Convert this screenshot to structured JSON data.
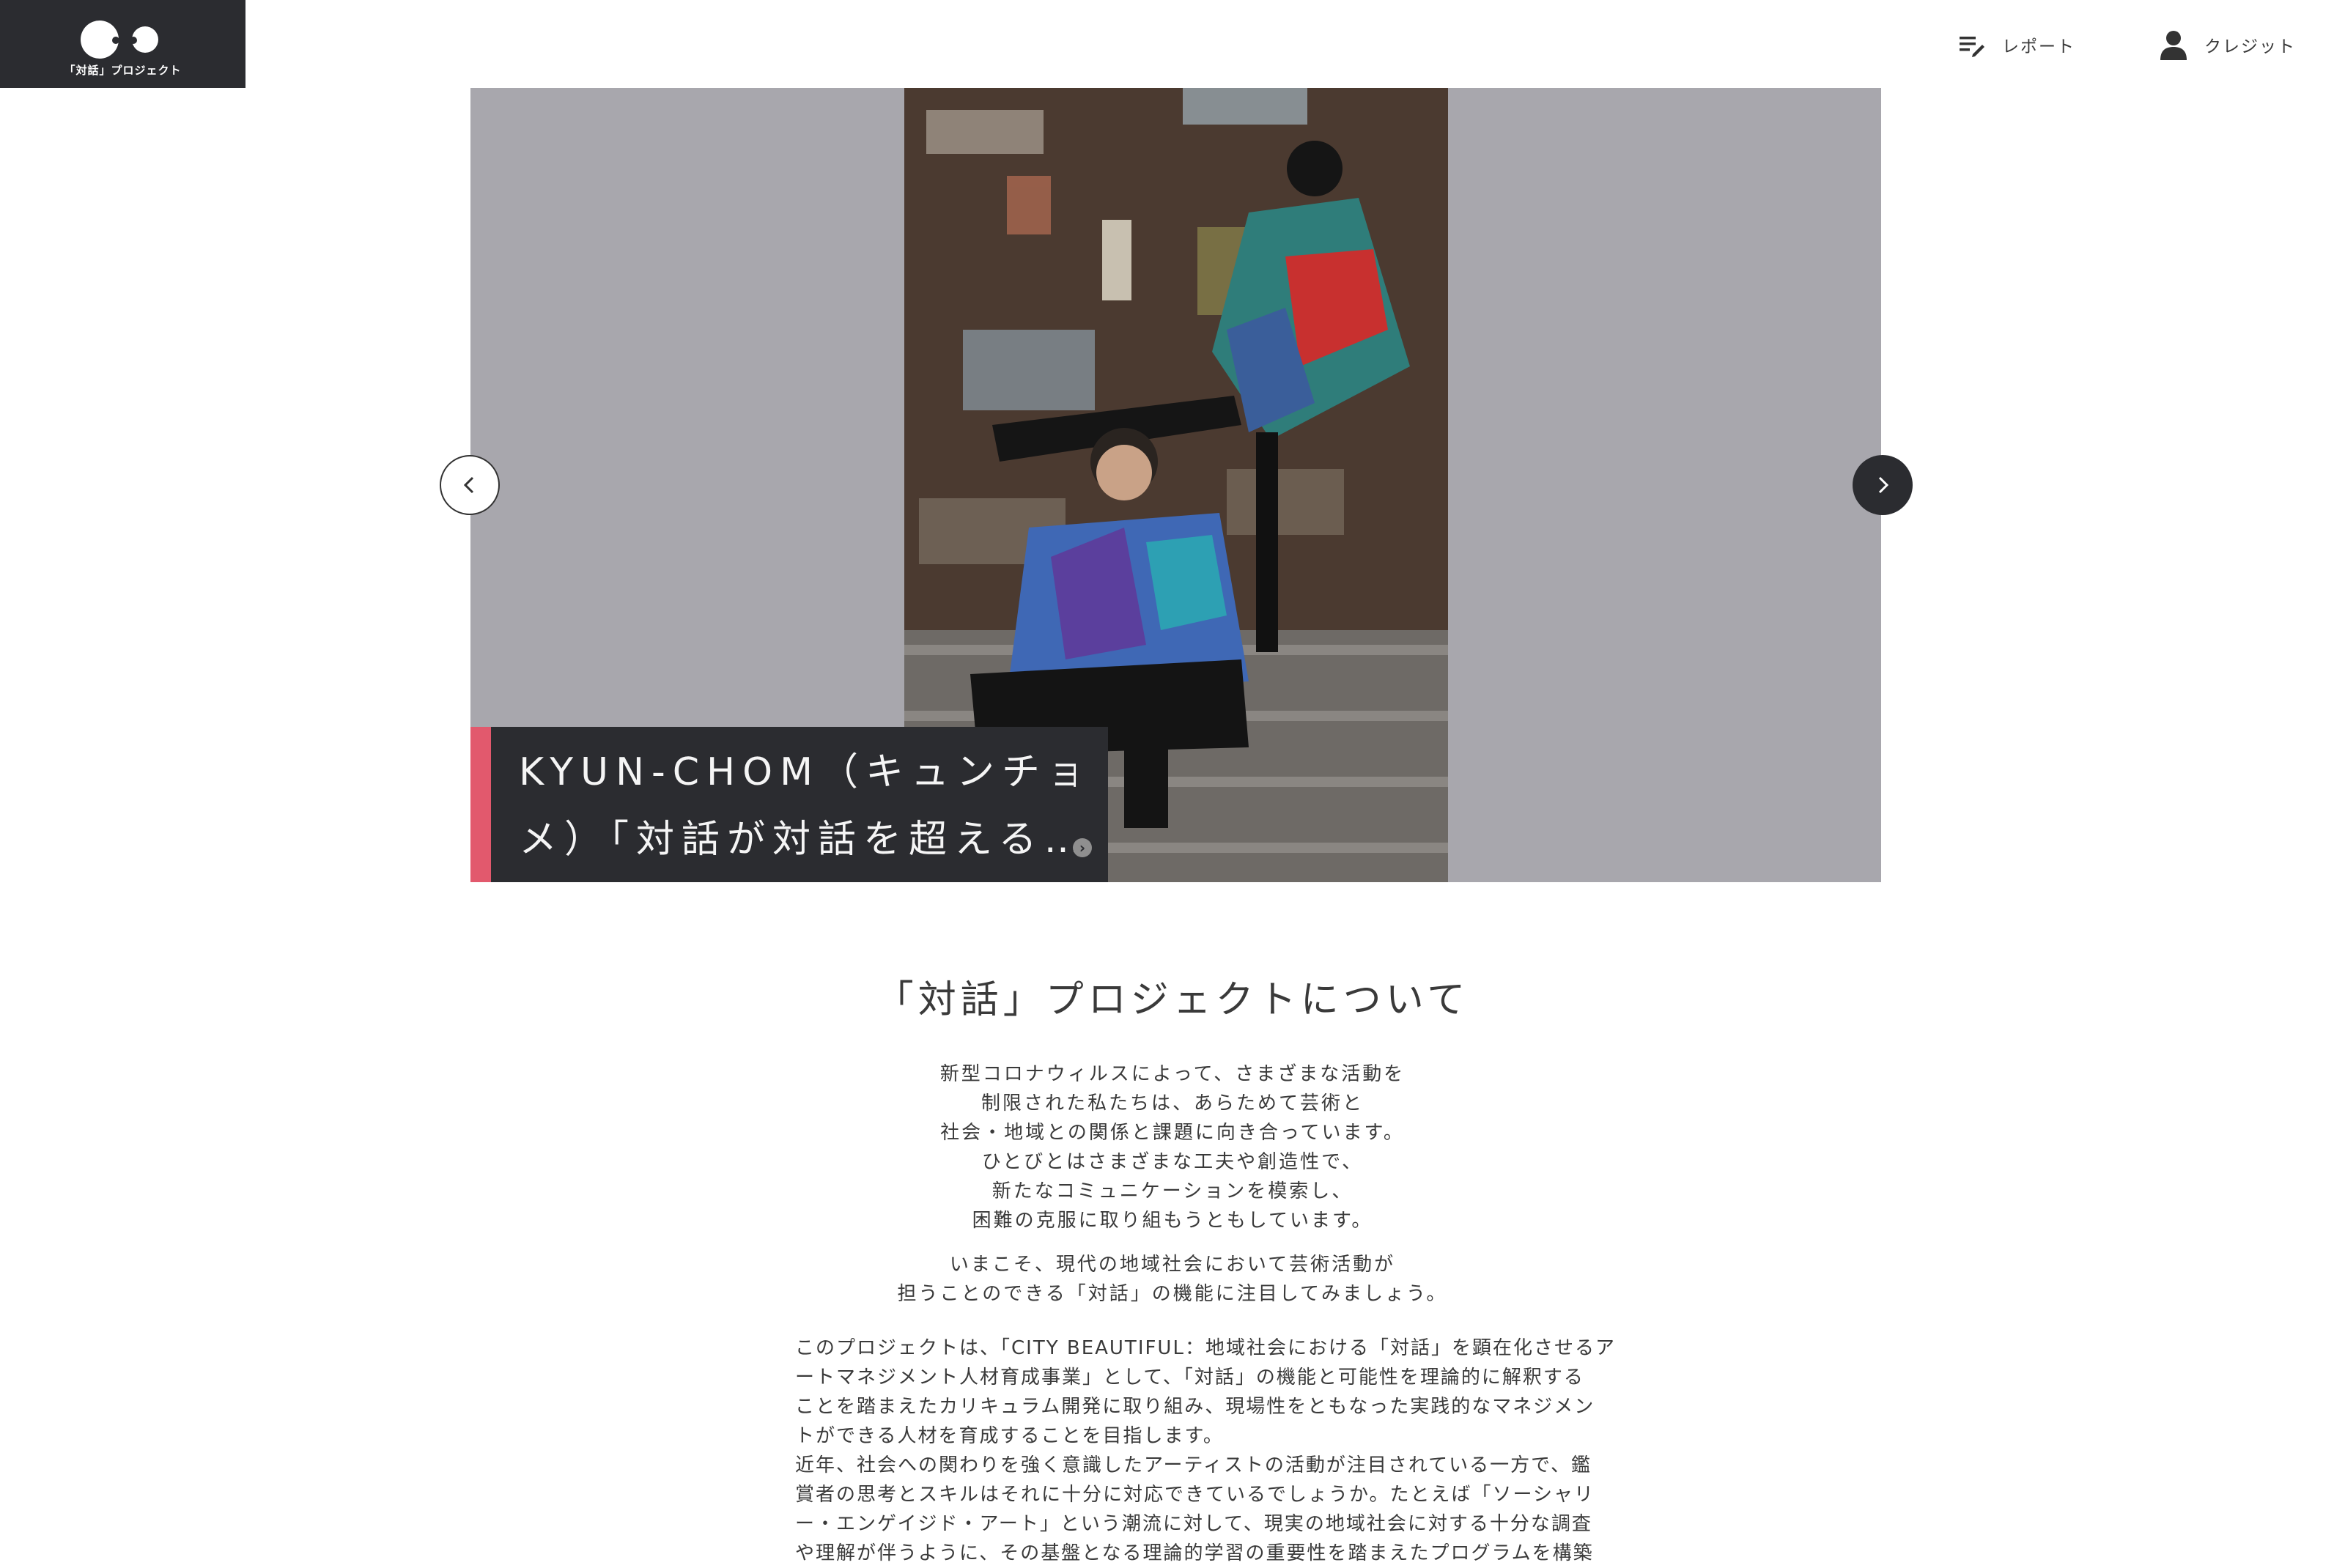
{
  "header": {
    "logo_text": "「対話」プロジェクト",
    "nav": [
      {
        "label": "レポート",
        "icon": "report-icon"
      },
      {
        "label": "クレジット",
        "icon": "user-icon"
      }
    ]
  },
  "hero": {
    "caption_lines": [
      "KYUN-CHOM（キュンチョ",
      "メ）「対話が対話を超える…"
    ],
    "more_icon": "chevron-right-small-icon",
    "prev_icon": "chevron-left-icon",
    "next_icon": "chevron-right-icon",
    "accent_color": "#e2596d",
    "background_color": "#a8a7ad"
  },
  "about": {
    "title": "「対話」プロジェクトについて",
    "intro_lines": [
      "新型コロナウィルスによって、さまざまな活動を",
      "制限された私たちは、あらためて芸術と",
      "社会・地域との関係と課題に向き合っています。",
      "ひとびとはさまざまな工夫や創造性で、",
      "新たなコミュニケーションを模索し、",
      "困難の克服に取り組もうともしています。"
    ],
    "emphasis_lines": [
      "いまこそ、現代の地域社会において芸術活動が",
      "担うことのできる「対話」の機能に注目してみましょう。"
    ],
    "body_lines": [
      "このプロジェクトは、「CITY BEAUTIFUL：地域社会における「対話」を顕在化させるア",
      "ートマネジメント人材育成事業」として、「対話」の機能と可能性を理論的に解釈する",
      "ことを踏まえたカリキュラム開発に取り組み、現場性をともなった実践的なマネジメン",
      "トができる人材を育成することを目指します。",
      "近年、社会への関わりを強く意識したアーティストの活動が注目されている一方で、鑑",
      "賞者の思考とスキルはそれに十分に対応できているでしょうか。たとえば「ソーシャリ",
      "ー・エンゲイジド・アート」という潮流に対して、現実の地域社会に対する十分な調査",
      "や理解が伴うように、その基盤となる理論的学習の重要性を踏まえたプログラムを構築"
    ]
  }
}
